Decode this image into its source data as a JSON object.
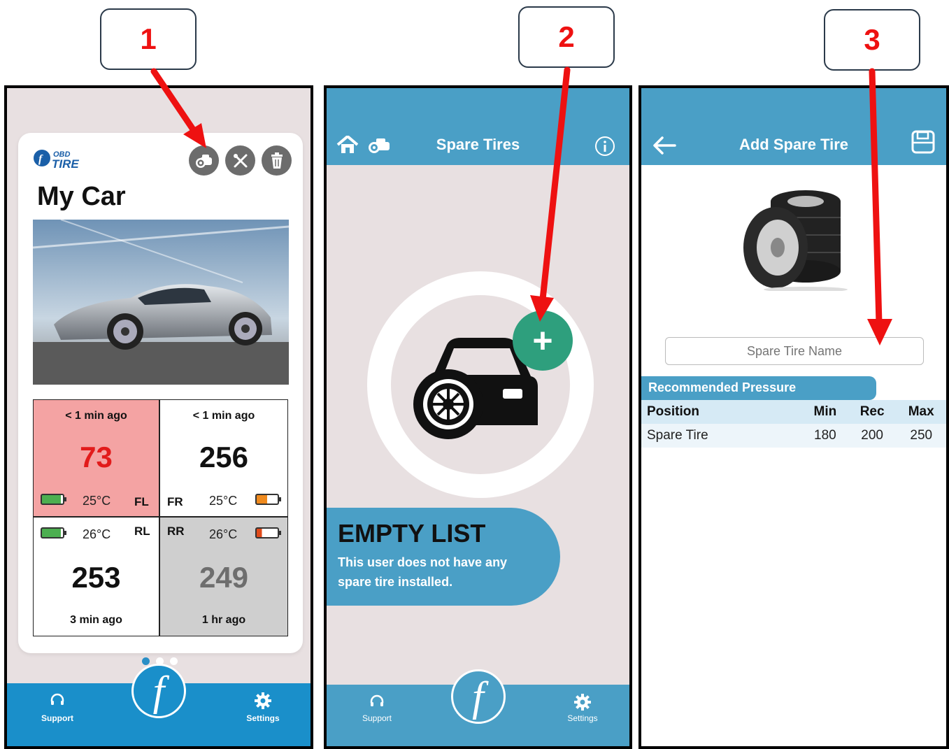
{
  "steps": [
    "1",
    "2",
    "3"
  ],
  "phone1": {
    "car_name": "My Car",
    "logo_small": "OBD",
    "logo_big": "TIRE",
    "icons": [
      "spare-tire-car-icon",
      "tools-icon",
      "trash-icon"
    ],
    "tires": {
      "fl": {
        "ago": "< 1 min ago",
        "value": "73",
        "temp": "25°C",
        "pos": "FL",
        "color": "#e21b1b"
      },
      "fr": {
        "ago": "< 1 min ago",
        "value": "256",
        "temp": "25°C",
        "pos": "FR",
        "color": "#111111"
      },
      "rl": {
        "ago": "3 min ago",
        "value": "253",
        "temp": "26°C",
        "pos": "RL",
        "color": "#111111"
      },
      "rr": {
        "ago": "1 hr ago",
        "value": "249",
        "temp": "26°C",
        "pos": "RR",
        "color": "#6e6e6e"
      }
    },
    "tabbar": {
      "support": "Support",
      "settings": "Settings"
    }
  },
  "phone2": {
    "title": "Spare Tires",
    "empty_heading": "EMPTY LIST",
    "empty_text": "This user does not have any spare tire installed.",
    "tabbar": {
      "support": "Support",
      "settings": "Settings"
    }
  },
  "phone3": {
    "title": "Add Spare Tire",
    "input_placeholder": "Spare Tire Name",
    "recommended_label": "Recommended Pressure",
    "table": {
      "headers": [
        "Position",
        "Min",
        "Rec",
        "Max"
      ],
      "rows": [
        [
          "Spare Tire",
          "180",
          "200",
          "250"
        ]
      ]
    }
  },
  "colors": {
    "accent": "#1a8fca",
    "header": "#4a9fc6",
    "danger": "#e21b1b",
    "add": "#2e9f7d",
    "arrow": "#ee1111"
  }
}
